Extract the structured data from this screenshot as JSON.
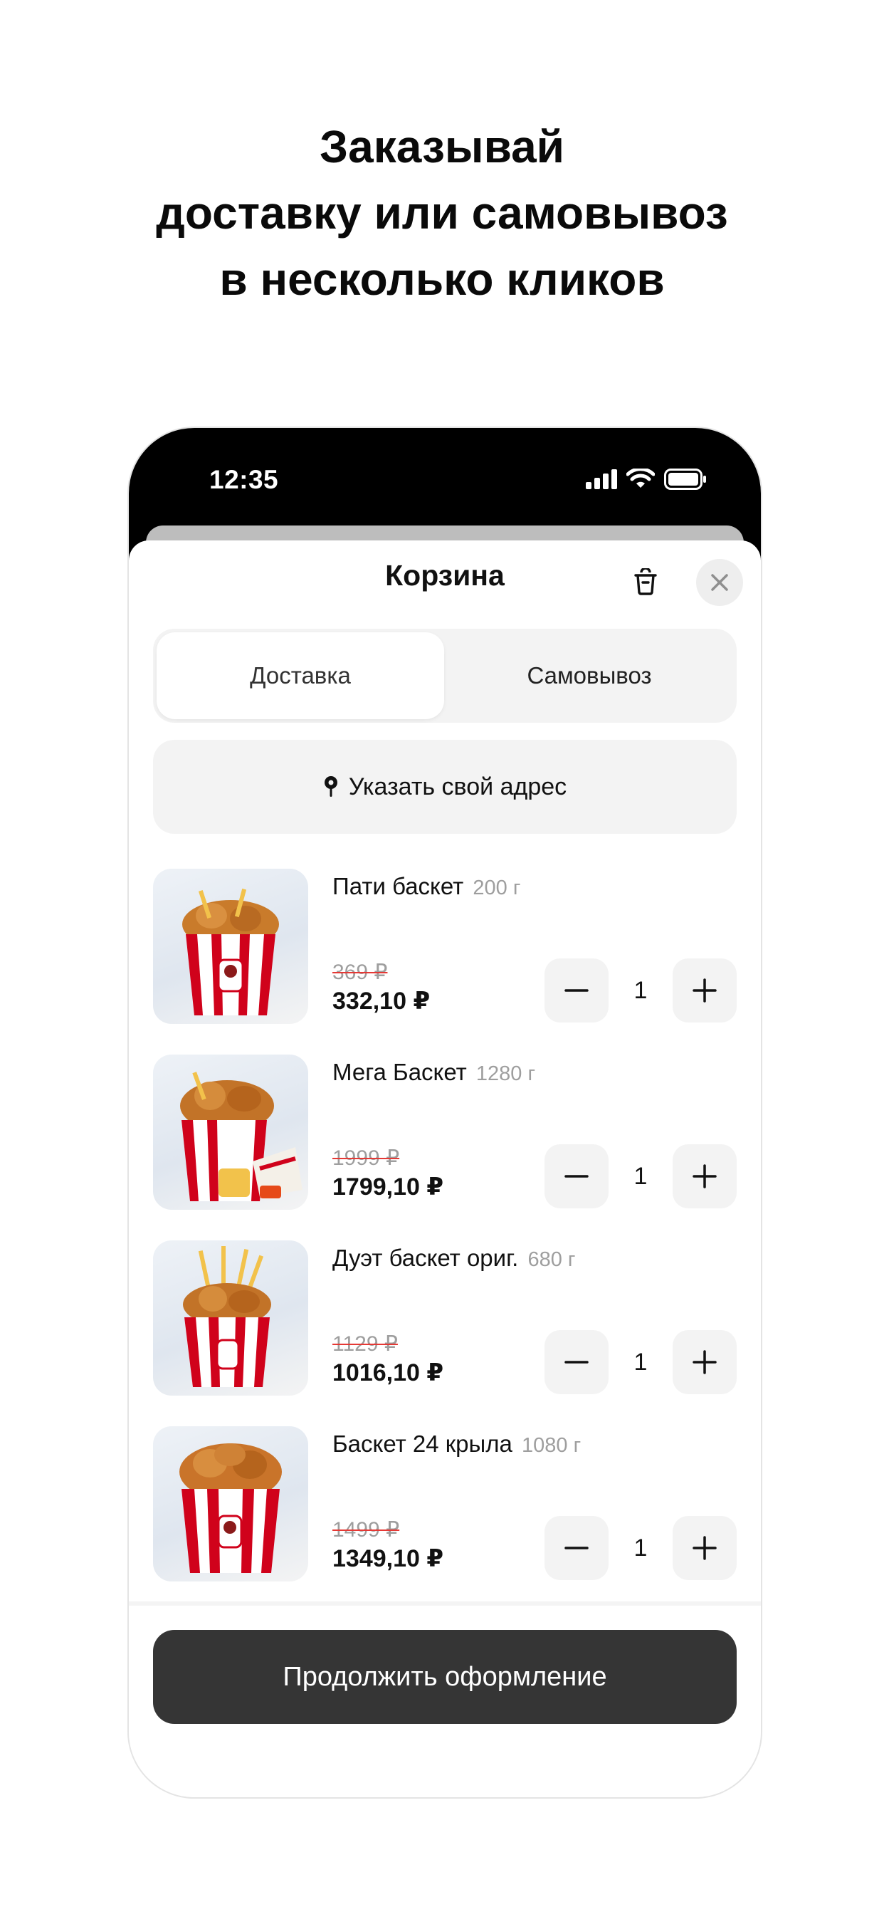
{
  "headline": {
    "line1": "Заказывай",
    "line2": "доставку или самовывоз",
    "line3": "в несколько кликов"
  },
  "status_bar": {
    "time": "12:35",
    "icons": [
      "cellular-signal-icon",
      "wifi-icon",
      "battery-icon"
    ]
  },
  "cart": {
    "title": "Корзина",
    "trash_icon": "trash-icon",
    "close_icon": "close-icon",
    "tabs": [
      {
        "label": "Доставка",
        "selected": true
      },
      {
        "label": "Самовывоз",
        "selected": false
      }
    ],
    "address": {
      "icon": "location-pin-icon",
      "label": "Указать свой адрес"
    },
    "items": [
      {
        "name": "Пати баскет",
        "weight": "200 г",
        "old_price": "369 ₽",
        "price": "332,10 ₽",
        "qty": "1"
      },
      {
        "name": "Мега Баскет",
        "weight": "1280 г",
        "old_price": "1999 ₽",
        "price": "1799,10 ₽",
        "qty": "1"
      },
      {
        "name": "Дуэт баскет ориг.",
        "weight": "680 г",
        "old_price": "1129 ₽",
        "price": "1016,10 ₽",
        "qty": "1"
      },
      {
        "name": "Баскет 24 крыла",
        "weight": "1080 г",
        "old_price": "1499 ₽",
        "price": "1349,10 ₽",
        "qty": "1"
      }
    ],
    "continue_label": "Продолжить оформление"
  },
  "colors": {
    "primary_button": "#353535",
    "strike_red": "#e53935",
    "surface": "#f3f3f3",
    "bucket_red": "#d0021b"
  }
}
